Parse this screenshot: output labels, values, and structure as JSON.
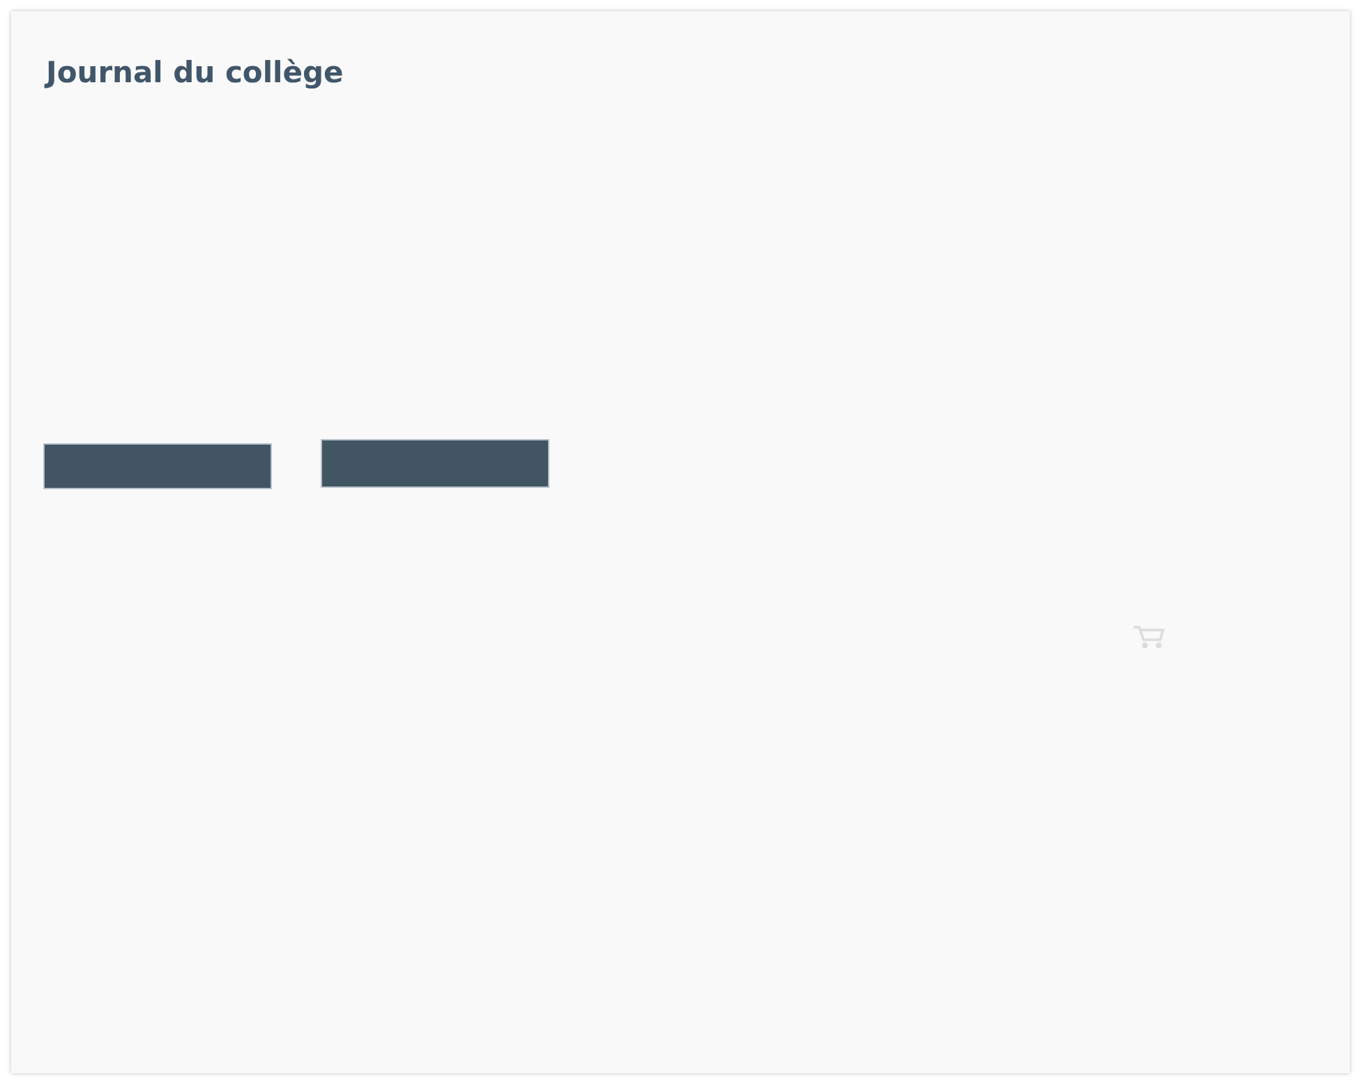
{
  "title": "Journal du collège"
}
